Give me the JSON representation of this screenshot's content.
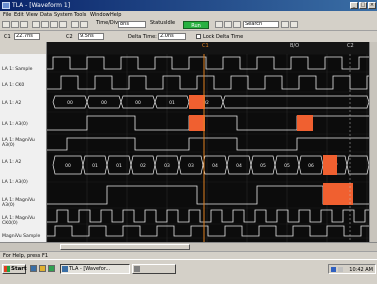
{
  "window": {
    "title": "TLA - [Waveform 1]"
  },
  "menu": [
    "File",
    "Edit",
    "View",
    "Data",
    "System",
    "Tools",
    "Window",
    "Help"
  ],
  "toolbar": {
    "status_label": "Status",
    "status_value": "Idle",
    "run_label": "Run",
    "timediv_label": "Time/Div",
    "timediv_value": "8ns",
    "search_value": "Search"
  },
  "cursors": {
    "c1_label": "C1",
    "c1_value": "22.7ns",
    "c2_label": "C2",
    "c2_value": "9.5ns",
    "delta_label": "Delta Time:",
    "delta_value": "2.0ns",
    "lock_label": "Lock Delta Time"
  },
  "header": {
    "marker": "C1",
    "right_label": "C2",
    "mid_label": "B/O"
  },
  "channels": [
    "LA 1: Sample",
    "LA 1: CK0",
    "LA 1: A2",
    "LA 1: A3(0)",
    "LA 1: MagniVu A3(0)",
    "LA 1: A2",
    "LA 1: A3(0)",
    "LA 1: MagniVu A3(0)",
    "LA 1: MagniVu CK0(0)",
    "MagniVu Sample"
  ],
  "bus_values": {
    "a2_top": [
      "00",
      "00",
      "00",
      "01",
      "02"
    ],
    "a2_mid": [
      "00",
      "01",
      "01",
      "02",
      "03",
      "03",
      "04",
      "04",
      "05",
      "05",
      "06",
      "07"
    ]
  },
  "status": {
    "help": "For Help, press F1"
  },
  "taskbar": {
    "start": "Start",
    "task1": "TLA - [Wavefor...",
    "task2": "",
    "clock": "10:42 AM"
  },
  "colors": {
    "wave": "#e8e8e8",
    "bus": "#e8e8e8",
    "highlight": "#f06030",
    "cursor": "#e08020",
    "grid": "#2a2a2a",
    "background": "#0c0c0c"
  }
}
